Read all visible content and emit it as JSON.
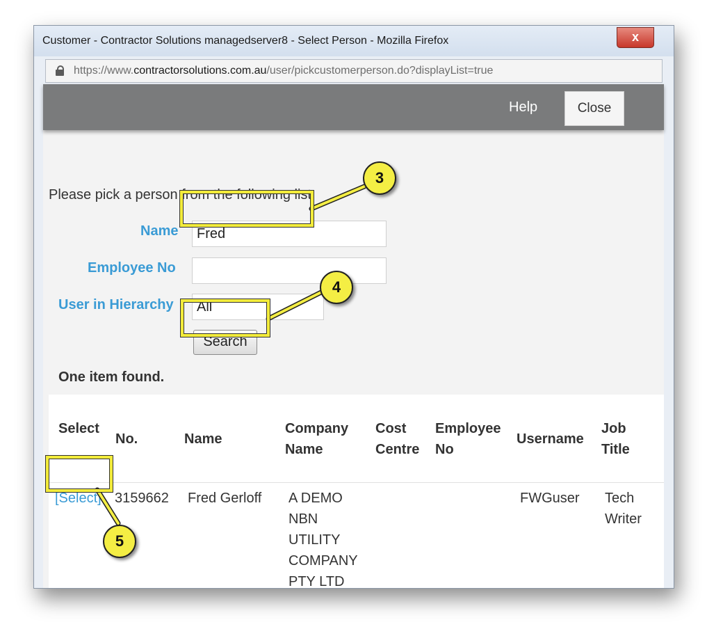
{
  "window": {
    "title": "Customer - Contractor Solutions  managedserver8 - Select Person - Mozilla Firefox",
    "close_glyph": "x"
  },
  "urlbar": {
    "prefix": "https://www.",
    "domain": "contractorsolutions.com.au",
    "path": "/user/pickcustomerperson.do?displayList=true"
  },
  "header": {
    "help_label": "Help",
    "close_label": "Close"
  },
  "form": {
    "instruction": "Please pick a person from the following list:",
    "name_label": "Name",
    "name_value": "Fred",
    "employee_no_label": "Employee No",
    "employee_no_value": "",
    "hierarchy_label": "User in Hierarchy",
    "hierarchy_value": "All",
    "search_label": "Search"
  },
  "results": {
    "count_text": "One item found.",
    "columns": {
      "select": "Select",
      "no": "No.",
      "name": "Name",
      "company_1": "Company",
      "company_2": "Name",
      "cost_1": "Cost",
      "cost_2": "Centre",
      "employee_1": "Employee",
      "employee_2": "No",
      "username": "Username",
      "job_1": "Job",
      "job_2": "Title"
    },
    "rows": [
      {
        "select_label": "[Select]",
        "no": "3159662",
        "name": "Fred Gerloff",
        "company_lines": [
          "A DEMO",
          "NBN",
          "UTILITY",
          "COMPANY",
          "PTY LTD"
        ],
        "cost_centre": "",
        "employee_no": "",
        "username": "FWGuser",
        "job_title_lines": [
          "Tech",
          "Writer"
        ]
      }
    ]
  },
  "callouts": {
    "step_3": "3",
    "step_4": "4",
    "step_5": "5",
    "color": "#f4ee44"
  }
}
